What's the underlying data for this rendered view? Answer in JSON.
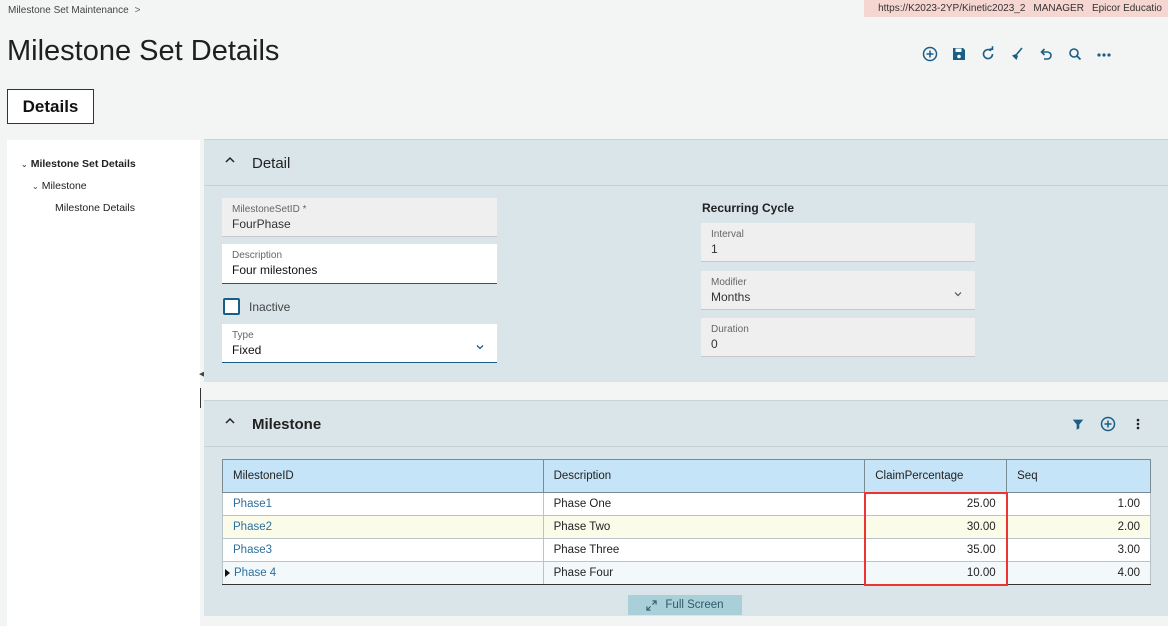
{
  "breadcrumb": {
    "app": "Milestone Set Maintenance",
    "sep": ">"
  },
  "env": {
    "url": "https://K2023-2YP/Kinetic2023_2",
    "user": "MANAGER",
    "company": "Epicor Educatio"
  },
  "page_title": "Milestone Set Details",
  "toolbar": {
    "icons": [
      "add-icon",
      "save-icon",
      "refresh-icon",
      "clear-icon",
      "undo-icon",
      "search-icon",
      "more-icon"
    ]
  },
  "tab": {
    "label": "Details"
  },
  "tree": {
    "items": [
      {
        "label": "Milestone Set Details",
        "level": 0
      },
      {
        "label": "Milestone",
        "level": 1
      },
      {
        "label": "Milestone Details",
        "level": 2
      }
    ]
  },
  "detail": {
    "title": "Detail",
    "milestoneSetId": {
      "label": "MilestoneSetID *",
      "value": "FourPhase"
    },
    "description": {
      "label": "Description",
      "value": "Four milestones"
    },
    "inactive": {
      "label": "Inactive",
      "checked": false
    },
    "type": {
      "label": "Type",
      "value": "Fixed"
    },
    "recurring": {
      "title": "Recurring Cycle",
      "interval": {
        "label": "Interval",
        "value": "1"
      },
      "modifier": {
        "label": "Modifier",
        "value": "Months"
      },
      "duration": {
        "label": "Duration",
        "value": "0"
      }
    }
  },
  "milestone": {
    "title": "Milestone",
    "columns": [
      "MilestoneID",
      "Description",
      "ClaimPercentage",
      "Seq"
    ],
    "rows": [
      {
        "id": "Phase1",
        "description": "Phase One",
        "claim": "25.00",
        "seq": "1.00"
      },
      {
        "id": "Phase2",
        "description": "Phase Two",
        "claim": "30.00",
        "seq": "2.00"
      },
      {
        "id": "Phase3",
        "description": "Phase Three",
        "claim": "35.00",
        "seq": "3.00"
      },
      {
        "id": "Phase 4",
        "description": "Phase Four",
        "claim": "10.00",
        "seq": "4.00"
      }
    ],
    "fullscreen_label": "Full Screen"
  },
  "colors": {
    "accent": "#1a5e86",
    "link": "#2b6f9e",
    "panel": "#d9e5e9",
    "header": "#c5e4f7",
    "highlight": "#e33333"
  }
}
